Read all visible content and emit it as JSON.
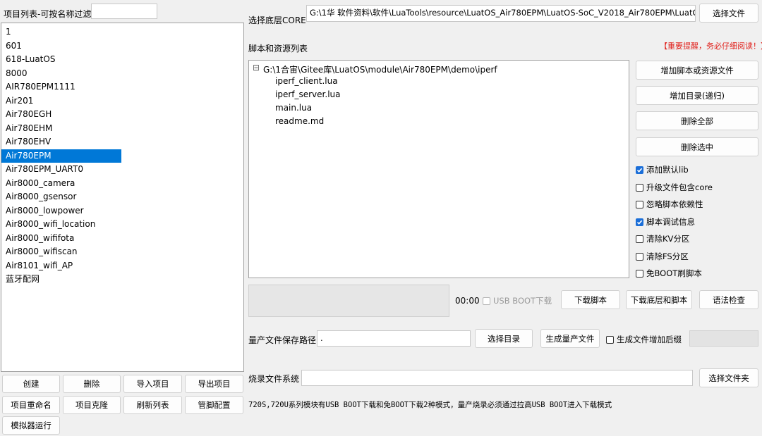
{
  "left_panel": {
    "filter_label": "项目列表-可按名称过滤",
    "filter_value": "",
    "projects": [
      "1",
      "601",
      "618-LuatOS",
      "8000",
      "AIR780EPM1111",
      "Air201",
      "Air780EGH",
      "Air780EHM",
      "Air780EHV",
      "Air780EPM",
      "Air780EPM_UART0",
      "Air8000_camera",
      "Air8000_gsensor",
      "Air8000_lowpower",
      "Air8000_wifi_location",
      "Air8000_wififota",
      "Air8000_wifiscan",
      "Air8101_wifi_AP",
      "蓝牙配网"
    ],
    "selected_project": "Air780EPM",
    "buttons": {
      "create": "创建",
      "delete": "删除",
      "import": "导入项目",
      "export": "导出项目",
      "rename": "项目重命名",
      "clone": "项目克隆",
      "refresh": "刷新列表",
      "pipe_config": "管脚配置",
      "simulator": "模拟器运行"
    }
  },
  "core": {
    "label": "选择底层CORE",
    "path": "G:\\1华  软件资料\\软件\\LuaTools\\resource\\LuatOS_Air780EPM\\LuatOS-SoC_V2018_Air780EPM\\LuatOS-S",
    "select_button": "选择文件"
  },
  "scripts": {
    "label": "脚本和资源列表",
    "warning": "【重要提醒，务必仔细阅读！】",
    "root": "G:\\1合宙\\Gitee库\\LuatOS\\module\\Air780EPM\\demo\\iperf",
    "collapse_glyph": "⊟",
    "files": [
      "iperf_client.lua",
      "iperf_server.lua",
      "main.lua",
      "readme.md"
    ],
    "buttons": {
      "add_file": "增加脚本或资源文件",
      "add_dir": "增加目录(递归)",
      "delete_all": "删除全部",
      "delete_selected": "删除选中"
    },
    "options": [
      {
        "label": "添加默认lib",
        "checked": true
      },
      {
        "label": "升级文件包含core",
        "checked": false
      },
      {
        "label": "忽略脚本依赖性",
        "checked": false
      },
      {
        "label": "脚本调试信息",
        "checked": true
      },
      {
        "label": "清除KV分区",
        "checked": false
      },
      {
        "label": "清除FS分区",
        "checked": false
      },
      {
        "label": "免BOOT刷脚本",
        "checked": false
      }
    ]
  },
  "download": {
    "timer": "00:00",
    "usb_boot_label": "USB BOOT下载",
    "usb_boot_checked": false,
    "download_script": "下载脚本",
    "download_core_script": "下载底层和脚本",
    "syntax_check": "语法检查"
  },
  "mass_production": {
    "path_label": "量产文件保存路径",
    "path_value": ".",
    "select_dir": "选择目录",
    "generate": "生成量产文件",
    "suffix_label": "生成文件增加后缀",
    "suffix_checked": false
  },
  "burn": {
    "label": "烧录文件系统",
    "value": "",
    "select_folder": "选择文件夹"
  },
  "footer_note": "720S,720U系列模块有USB BOOT下载和免BOOT下载2种模式，量产烧录必须通过拉高USB BOOT进入下载模式"
}
